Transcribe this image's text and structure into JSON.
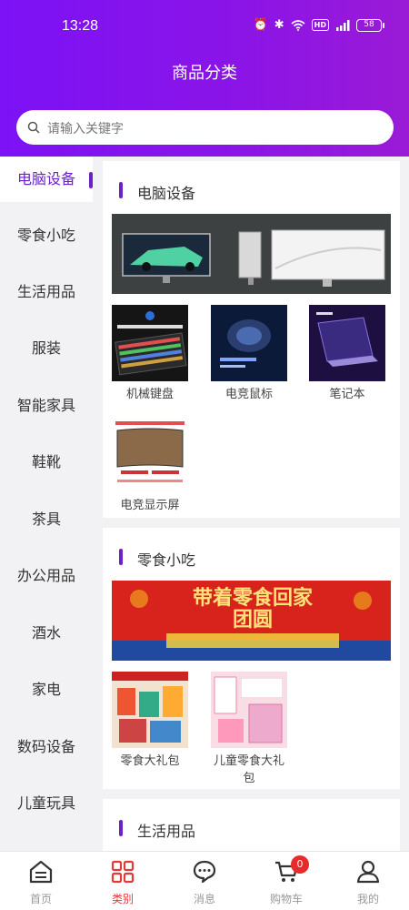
{
  "status_bar": {
    "time": "13:28",
    "battery": "58"
  },
  "header": {
    "title": "商品分类"
  },
  "search": {
    "placeholder": "请输入关键字"
  },
  "sidebar": {
    "items": [
      {
        "label": "电脑设备",
        "active": true
      },
      {
        "label": "零食小吃"
      },
      {
        "label": "生活用品"
      },
      {
        "label": "服装"
      },
      {
        "label": "智能家具"
      },
      {
        "label": "鞋靴"
      },
      {
        "label": "茶具"
      },
      {
        "label": "办公用品"
      },
      {
        "label": "酒水"
      },
      {
        "label": "家电"
      },
      {
        "label": "数码设备"
      },
      {
        "label": "儿童玩具"
      }
    ]
  },
  "sections": [
    {
      "title": "电脑设备",
      "products": [
        {
          "name": "机械键盘"
        },
        {
          "name": "电竞鼠标"
        },
        {
          "name": "笔记本"
        },
        {
          "name": "电竞显示屏"
        }
      ]
    },
    {
      "title": "零食小吃",
      "banner_text": "带着零食回家团圆",
      "products": [
        {
          "name": "零食大礼包"
        },
        {
          "name": "儿童零食大礼包"
        }
      ]
    },
    {
      "title": "生活用品"
    }
  ],
  "tabbar": {
    "items": [
      {
        "label": "首页",
        "icon": "home-icon"
      },
      {
        "label": "类别",
        "icon": "category-icon",
        "active": true
      },
      {
        "label": "消息",
        "icon": "message-icon"
      },
      {
        "label": "购物车",
        "icon": "cart-icon",
        "badge": "0"
      },
      {
        "label": "我的",
        "icon": "profile-icon"
      }
    ]
  },
  "colors": {
    "header_start": "#7c12f5",
    "header_end": "#9a1ad6",
    "accent": "#6a22c8",
    "tab_active": "#e33a3a",
    "badge": "#e82a2a"
  }
}
